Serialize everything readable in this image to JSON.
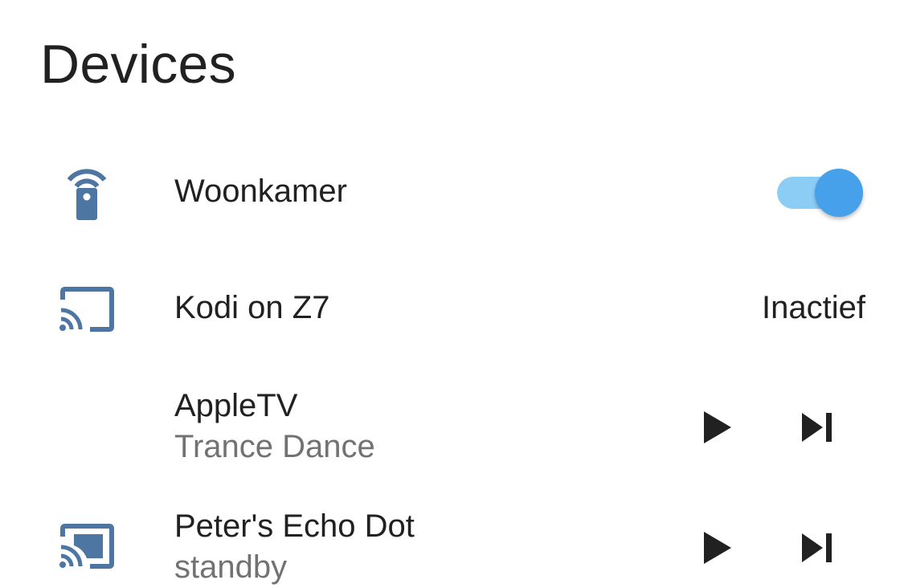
{
  "card": {
    "title": "Devices"
  },
  "colors": {
    "icon": "#4e76a2",
    "toggle_track": "#8ccdf6",
    "toggle_thumb": "#46a1ea",
    "primary_text": "#212121",
    "secondary_text": "#727272"
  },
  "devices": [
    {
      "name": "Woonkamer",
      "icon": "remote-icon",
      "control": "toggle",
      "toggle_on": true
    },
    {
      "name": "Kodi on Z7",
      "icon": "cast-icon",
      "state": "Inactief"
    },
    {
      "name": "AppleTV",
      "secondary": "Trance Dance",
      "controls": [
        "play-icon",
        "skip-next-icon"
      ]
    },
    {
      "name": "Peter's Echo Dot",
      "icon": "cast-connected-icon",
      "secondary": "standby",
      "controls": [
        "play-icon",
        "skip-next-icon"
      ]
    }
  ]
}
